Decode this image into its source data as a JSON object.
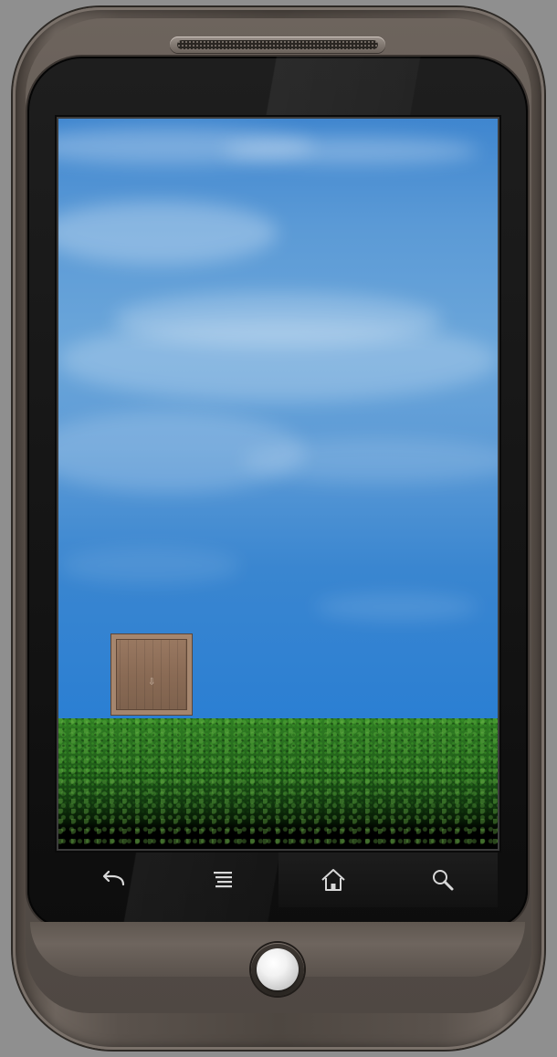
{
  "device": {
    "model_icon": "nexus-one-phone-frame"
  },
  "game": {
    "scene": "sky-and-grass",
    "sky_color": "#4f93d4",
    "grass_color": "#2f7e22",
    "crate": {
      "stencil_text": "",
      "texture": "wooden-crate"
    }
  },
  "navbar": {
    "keys": [
      {
        "name": "back",
        "icon": "back-arrow-icon"
      },
      {
        "name": "menu",
        "icon": "menu-icon"
      },
      {
        "name": "home",
        "icon": "home-icon"
      },
      {
        "name": "search",
        "icon": "search-icon"
      }
    ]
  },
  "colors": {
    "frame": "#5a524c",
    "bezel": "#141414",
    "background": "#8f8f8f"
  }
}
